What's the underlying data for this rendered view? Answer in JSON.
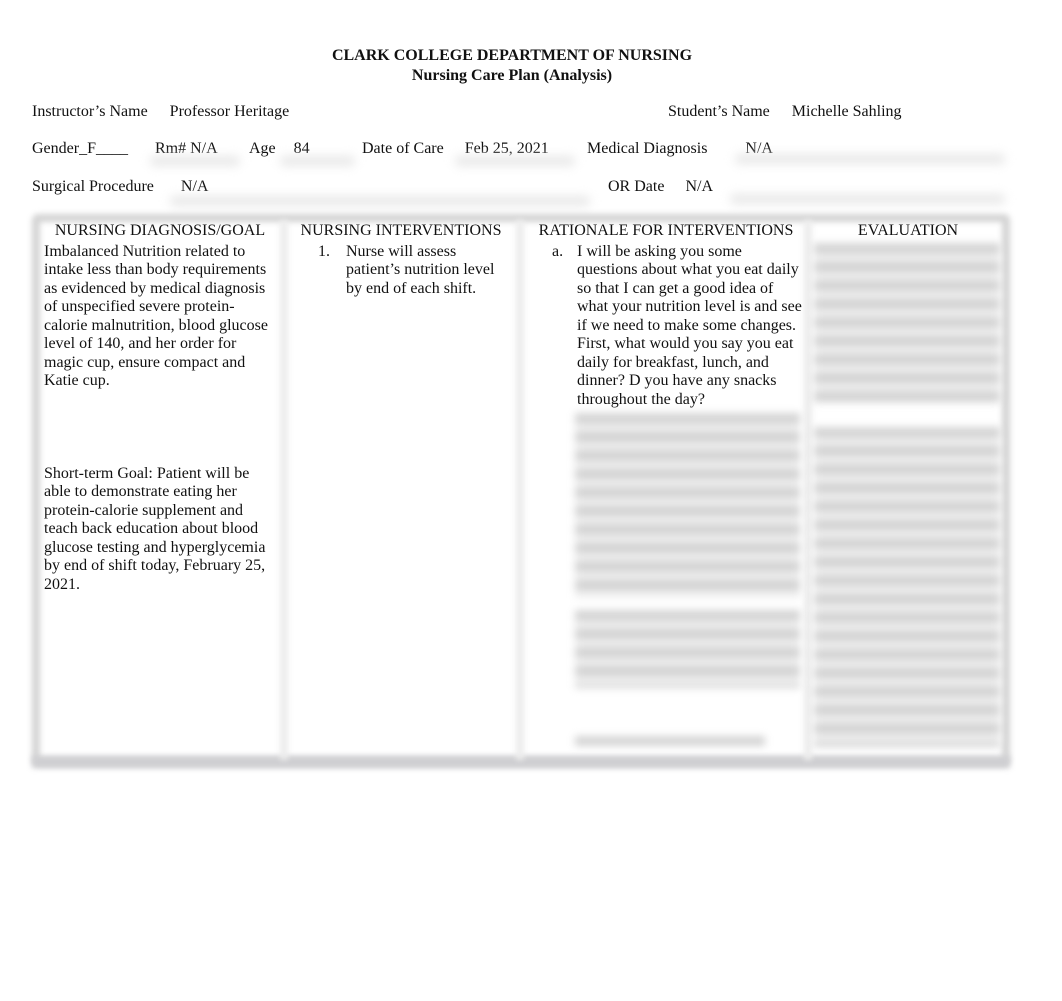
{
  "header": {
    "institution": "CLARK COLLEGE DEPARTMENT OF NURSING",
    "document_title": "Nursing Care Plan (Analysis)"
  },
  "fields": {
    "instructor_label": "Instructor’s Name",
    "instructor_value": "Professor Heritage",
    "student_label": "Student’s Name",
    "student_value": "Michelle Sahling",
    "gender": "Gender_F____",
    "room_label": "Rm#",
    "room_value": "N/A",
    "age_label": "Age",
    "age_value": "84",
    "date_of_care_label": "Date of Care",
    "date_of_care_value": "Feb 25, 2021",
    "medical_diagnosis_label": "Medical Diagnosis",
    "medical_diagnosis_value": "N/A",
    "surgical_procedure_label": "Surgical Procedure",
    "surgical_procedure_value": "N/A",
    "or_date_label": "OR Date",
    "or_date_value": "N/A"
  },
  "table": {
    "headers": [
      "NURSING DIAGNOSIS/GOAL",
      "NURSING INTERVENTIONS",
      "RATIONALE FOR INTERVENTIONS",
      "EVALUATION"
    ],
    "diagnosis": {
      "text": "Imbalanced Nutrition related to intake less than body requirements as evidenced by medical diagnosis of unspecified severe protein-calorie malnutrition, blood glucose level of 140, and her order for magic cup, ensure compact and Katie cup.",
      "short_term_goal": "Short-term Goal: Patient will be able to demonstrate eating her protein-calorie supplement and teach back education about blood glucose testing and hyperglycemia by end of shift today, February 25, 2021."
    },
    "interventions": [
      {
        "marker": "1.",
        "text": "Nurse will assess patient’s nutrition level by end of each shift."
      }
    ],
    "rationale": [
      {
        "marker": "a.",
        "text": "I will be asking you some questions about what you eat daily so that I can get a good idea of what your nutrition level is and see if we need to make some changes. First, what would you say you eat daily for breakfast, lunch, and dinner? D you have any snacks throughout the day?"
      }
    ]
  }
}
